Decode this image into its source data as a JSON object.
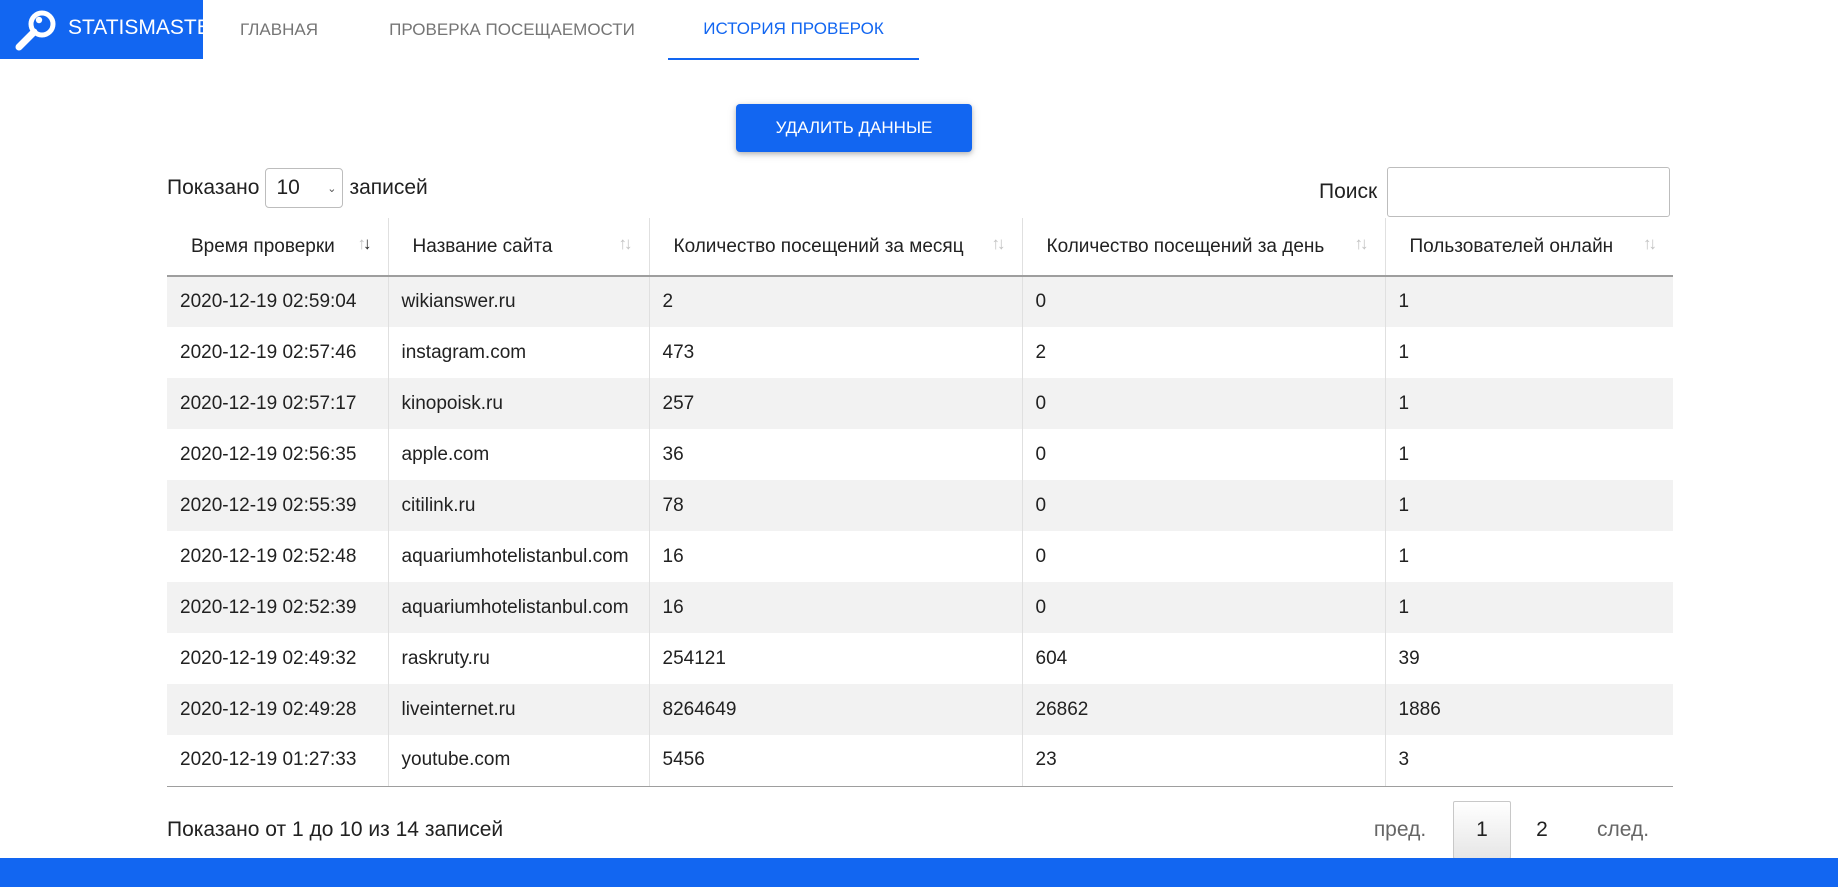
{
  "brand": {
    "name": "STATISMASTER",
    "logo_icon": "magnifier-icon",
    "color": "#1266f1"
  },
  "nav": {
    "items": [
      {
        "label": "ГЛАВНАЯ",
        "active": false
      },
      {
        "label": "ПРОВЕРКА ПОСЕЩАЕМОСТИ",
        "active": false
      },
      {
        "label": "ИСТОРИЯ ПРОВЕРОК",
        "active": true
      }
    ]
  },
  "actions": {
    "delete_label": "УДАЛИТЬ ДАННЫЕ"
  },
  "controls": {
    "show_prefix": "Показано",
    "page_size": "10",
    "show_suffix": "записей",
    "search_label": "Поиск",
    "search_value": ""
  },
  "table": {
    "columns": [
      "Время проверки",
      "Название сайта",
      "Количество посещений за месяц",
      "Количество посещений за день",
      "Пользователей онлайн"
    ],
    "sorted_column": 0,
    "sort_direction": "desc",
    "rows": [
      [
        "2020-12-19 02:59:04",
        "wikianswer.ru",
        "2",
        "0",
        "1"
      ],
      [
        "2020-12-19 02:57:46",
        "instagram.com",
        "473",
        "2",
        "1"
      ],
      [
        "2020-12-19 02:57:17",
        "kinopoisk.ru",
        "257",
        "0",
        "1"
      ],
      [
        "2020-12-19 02:56:35",
        "apple.com",
        "36",
        "0",
        "1"
      ],
      [
        "2020-12-19 02:55:39",
        "citilink.ru",
        "78",
        "0",
        "1"
      ],
      [
        "2020-12-19 02:52:48",
        "aquariumhotelistanbul.com",
        "16",
        "0",
        "1"
      ],
      [
        "2020-12-19 02:52:39",
        "aquariumhotelistanbul.com",
        "16",
        "0",
        "1"
      ],
      [
        "2020-12-19 02:49:32",
        "raskruty.ru",
        "254121",
        "604",
        "39"
      ],
      [
        "2020-12-19 02:49:28",
        "liveinternet.ru",
        "8264649",
        "26862",
        "1886"
      ],
      [
        "2020-12-19 01:27:33",
        "youtube.com",
        "5456",
        "23",
        "3"
      ]
    ]
  },
  "footer": {
    "info": "Показано от 1 до 10 из 14 записей",
    "prev_label": "пред.",
    "pages": [
      "1",
      "2"
    ],
    "current_page": "1",
    "next_label": "след."
  }
}
